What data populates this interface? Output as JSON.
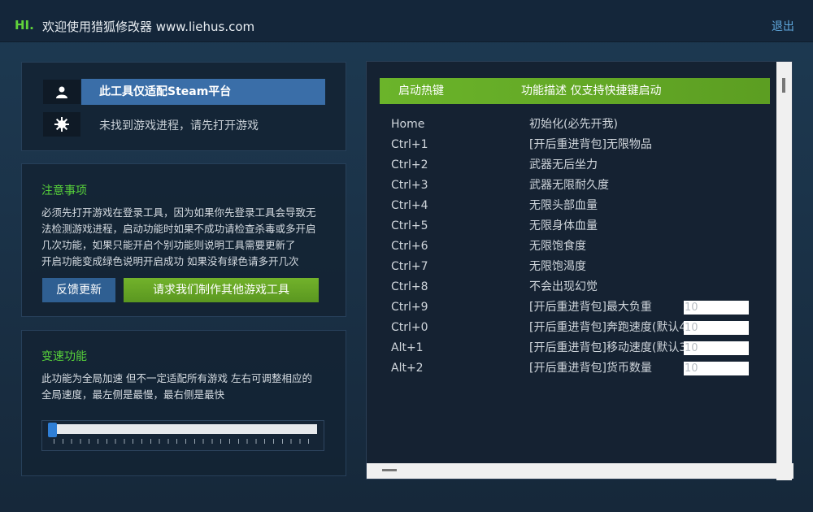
{
  "header": {
    "hi": "HI.",
    "welcome": "欢迎使用猎狐修改器 www.liehus.com",
    "logout": "退出"
  },
  "platform": {
    "steam_label": "此工具仅适配Steam平台",
    "status": "未找到游戏进程，请先打开游戏",
    "user_icon": "user-icon",
    "gear_icon": "gear-icon"
  },
  "notice": {
    "title": "注意事项",
    "text": "必须先打开游戏在登录工具，因为如果你先登录工具会导致无\n法检测游戏进程，启动功能时如果不成功请检查杀毒或多开启\n几次功能，如果只能开启个别功能则说明工具需要更新了\n开启功能变成绿色说明开启成功 如果没有绿色请多开几次",
    "feedback_button": "反馈更新",
    "request_button": "请求我们制作其他游戏工具"
  },
  "speed": {
    "title": "变速功能",
    "text": "此功能为全局加速 但不一定适配所有游戏 左右可调整相应的\n全局速度，最左侧是最慢，最右侧是最快",
    "level": 0
  },
  "hotkeys": {
    "header_key": "启动热键",
    "header_desc": "功能描述 仅支持快捷键启动",
    "rows": [
      {
        "key": "Home",
        "desc": "初始化(必先开我)",
        "value": null
      },
      {
        "key": "Ctrl+1",
        "desc": "[开后重进背包]无限物品",
        "value": null
      },
      {
        "key": "Ctrl+2",
        "desc": "武器无后坐力",
        "value": null
      },
      {
        "key": "Ctrl+3",
        "desc": "武器无限耐久度",
        "value": null
      },
      {
        "key": "Ctrl+4",
        "desc": "无限头部血量",
        "value": null
      },
      {
        "key": "Ctrl+5",
        "desc": "无限身体血量",
        "value": null
      },
      {
        "key": "Ctrl+6",
        "desc": "无限饱食度",
        "value": null
      },
      {
        "key": "Ctrl+7",
        "desc": "无限饱渴度",
        "value": null
      },
      {
        "key": "Ctrl+8",
        "desc": "不会出现幻觉",
        "value": null
      },
      {
        "key": "Ctrl+9",
        "desc": "[开后重进背包]最大负重",
        "value": "10"
      },
      {
        "key": "Ctrl+0",
        "desc": "[开后重进背包]奔跑速度(默认4",
        "value": "10"
      },
      {
        "key": "Alt+1",
        "desc": "[开后重进背包]移动速度(默认3",
        "value": "10"
      },
      {
        "key": "Alt+2",
        "desc": "[开后重进背包]货币数量",
        "value": "10"
      }
    ]
  }
}
